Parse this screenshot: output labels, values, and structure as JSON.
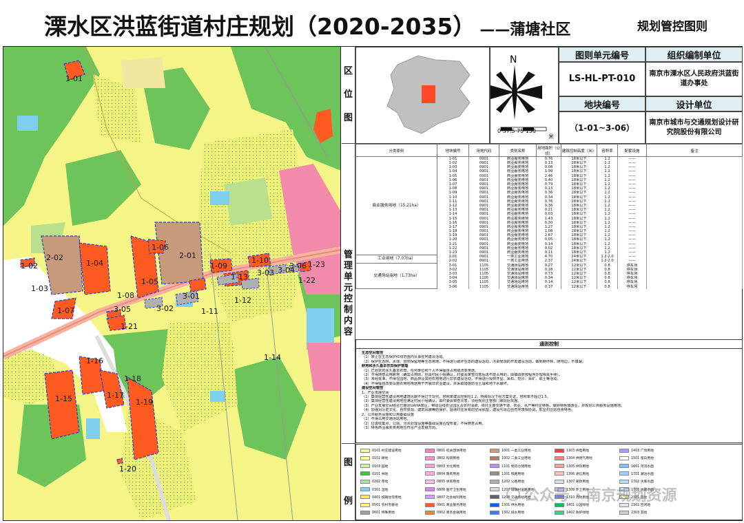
{
  "header": {
    "title": "溧水区洪蓝街道村庄规划（2020-2035）",
    "subtitle": "——蒲塘社区",
    "sheet_name": "规划管控图则"
  },
  "panel": {
    "location_label": [
      "区",
      "位",
      "图"
    ],
    "scale_label": "0 37.5 75    150",
    "scale_unit": "米",
    "north": "N",
    "unit_no_header": "图则单元编号",
    "unit_no": "LS-HL-PT-010",
    "plot_no_header": "地块编号",
    "plot_no": "（1-01~3-06）",
    "org_header": "组织编制单位",
    "org": "南京市溧水区人民政府洪蓝街道办事处",
    "design_header": "设计单位",
    "design": "南京市城市与交通规划设计研究院股份有限公司",
    "mgmt_label": [
      "管",
      "理",
      "单",
      "元",
      "控",
      "制",
      "内",
      "容"
    ],
    "legend_label": [
      "图",
      "例"
    ]
  },
  "table": {
    "headers": [
      "分类原则",
      "地块编号",
      "用地代码",
      "类别名称",
      "用地面积（公顷）",
      "建筑控制高度（米）",
      "容积率",
      "配套设施",
      "备注"
    ],
    "groups": [
      {
        "name": "商业服务用地（15.21ha）",
        "rows": [
          [
            "1-01",
            "0901",
            "商业服务用地",
            "0.76",
            "18米以下",
            "1.2",
            "——"
          ],
          [
            "1-02",
            "0901",
            "商业服务用地",
            "0.13",
            "18米以下",
            "1.2",
            "——"
          ],
          [
            "1-03",
            "0901",
            "商业服务用地",
            "0.08",
            "18米以下",
            "1.2",
            "——"
          ],
          [
            "1-04",
            "0901",
            "商业服务用地",
            "1.99",
            "18米以下",
            "1.2",
            "——"
          ],
          [
            "1-05",
            "0901",
            "商业服务用地",
            "2.46",
            "18米以下",
            "1.2",
            "——"
          ],
          [
            "1-06",
            "0901",
            "商业服务用地",
            "0.40",
            "18米以下",
            "1.2",
            "——"
          ],
          [
            "1-07",
            "0901",
            "商业服务用地",
            "0.79",
            "18米以下",
            "1.2",
            "——"
          ],
          [
            "1-08",
            "0901",
            "商业服务用地",
            "0.13",
            "18米以下",
            "1.2",
            "——"
          ],
          [
            "1-09",
            "0901",
            "商业服务用地",
            "0.36",
            "18米以下",
            "1.2",
            "——"
          ],
          [
            "1-10",
            "0901",
            "商业服务用地",
            "0.34",
            "18米以下",
            "1.2",
            "——"
          ],
          [
            "1-11",
            "0901",
            "商业服务用地",
            "0.76",
            "18米以下",
            "1.2",
            "——"
          ],
          [
            "1-12",
            "0901",
            "商业服务用地",
            "0.36",
            "18米以下",
            "1.2",
            "——"
          ],
          [
            "1-13",
            "0901",
            "商业服务用地",
            "0.21",
            "18米以下",
            "1.2",
            "——"
          ],
          [
            "1-14",
            "0901",
            "商业服务用地",
            "0.03",
            "18米以下",
            "1.2",
            "——"
          ],
          [
            "1-15",
            "0901",
            "商业服务用地",
            "1.43",
            "18米以下",
            "1.2",
            "——"
          ],
          [
            "1-16",
            "0901",
            "商业服务用地",
            "0.30",
            "18米以下",
            "1.2",
            "——"
          ],
          [
            "1-17",
            "0901",
            "商业服务用地",
            "1.27",
            "18米以下",
            "1.2",
            "——"
          ],
          [
            "1-18",
            "0901",
            "商业服务用地",
            "1.08",
            "18米以下",
            "1.2",
            "——"
          ],
          [
            "1-19",
            "0901",
            "商业服务用地",
            "2.67",
            "18米以下",
            "1.2",
            "——"
          ],
          [
            "1-20",
            "0901",
            "商业服务用地",
            "0.05",
            "18米以下",
            "1.2",
            "——"
          ],
          [
            "1-21",
            "0901",
            "商业服务用地",
            "0.14",
            "18米以下",
            "1.2",
            "——"
          ],
          [
            "1-22",
            "0901",
            "商业服务用地",
            "0.02",
            "18米以下",
            "1.2",
            "——"
          ],
          [
            "1-23",
            "0901",
            "商业服务用地",
            "0.11",
            "18米以下",
            "1.2",
            "——"
          ]
        ]
      },
      {
        "name": "工业用地（7.07ha）",
        "rows": [
          [
            "2-01",
            "0901",
            "一类工业用地",
            "4.70",
            "24米以下",
            "1.2-2.0",
            "——"
          ],
          [
            "2-02",
            "0901",
            "一类工业用地",
            "2.37",
            "24米以下",
            "1.2-2.0",
            "——"
          ]
        ]
      },
      {
        "name": "交通场站用地（1.73ha）",
        "rows": [
          [
            "3-01",
            "1105",
            "交通场站用地",
            "0.27",
            "12米以下",
            "0.8",
            "停车场"
          ],
          [
            "3-02",
            "1105",
            "交通场站用地",
            "0.28",
            "12米以下",
            "0.8",
            "停车场"
          ],
          [
            "3-03",
            "1105",
            "交通场站用地",
            "0.73",
            "12米以下",
            "0.8",
            "停车场"
          ],
          [
            "3-04",
            "1105",
            "交通场站用地",
            "0.34",
            "12米以下",
            "0.8",
            "停车场"
          ],
          [
            "3-05",
            "1105",
            "交通场站用地",
            "0.14",
            "12米以下",
            "0.8",
            "停车场"
          ],
          [
            "3-06",
            "1105",
            "交通场站用地",
            "0.37",
            "12米以下",
            "0.8",
            "停车场"
          ]
        ]
      }
    ]
  },
  "rules": {
    "title": "通则控制",
    "lines": [
      "生态空间管控",
      "（1）禁止在生态保护红线范围内从事任何建设活动。",
      "（2）保护生态林、水体、自然保留地等生态用地，不得进行破坏生态的建设活动，污染景观的开发建设活动，做到随坏林、随地边，不填湖。",
      "耕地和永久基本农田保护管理",
      "（1）已划定的永久基本农田，任何单位和个人不得擅自占用或改变用途。",
      "（2）不得随意占用耕地（确需占用的，应由村民小组确认，村委会审查同意后再不能占用的，由镇政府按程序办理相关手续）。",
      "（3）未经批准，不得在园地、商品林及其他农用地进行非农建设活动，不得进行毁林开垦、采石、挖沙、采矿、取土等活动。",
      "（4）不得擅自改变设施农用地用途用于开展非农业建设，并采取措施防治土壤和地下水破坏。",
      "建设空间管控",
      "1、产业发展空间",
      "（1）集体经营性建设用地建筑风貌不得过于现代，容积率建议控制在1.2，特殊情况下经方案论证，容积率不超过1.5。",
      "（2）集体经营性建设用地应满足村民小组确认、由村委会审查同意，须经规划主管部门审批后实施。",
      "（3）产业发展空间结合已整治UAHA景区，带动沿线农业园区及农村消费，依托主要交通干道、农业、水产等村庄特色，做好特色旅游业，并规划公共服务设施用地。",
      "（4）加强对历史文化、自然景观、建筑风貌等的保护，延续村庄原有的空间肌理，建设与周边自然环境相协调，彰显村庄的自身特色。",
      "2、公共服务设施和公用基础设施",
      "（1）不得占用交通场站用地。",
      "（2）垃圾收集点、公厕、污水处理设施等基础设施合理布置，不得随意占用。",
      "（3）特色商业服务类用地应符合产业发展方向。"
    ]
  },
  "legend_items": [
    [
      "0101 村庄建设用地",
      "#f5f5a0"
    ],
    [
      "0102 耕地",
      "#ffff99"
    ],
    [
      "0103 园地",
      "#d4f0a8"
    ],
    [
      "0201 林地",
      "#33cc33"
    ],
    [
      "0202 草地",
      "#a8e0a0"
    ],
    [
      "0301 湿地",
      "#80d0ff"
    ],
    [
      "0401 城镇住宅用地",
      "#ffe080"
    ],
    [
      "0501 农村宅基地",
      "#fff080"
    ],
    [
      "0601 特殊用地",
      "#a0a0a0"
    ],
    [
      "0801 机关团体用地",
      "#ff80c0"
    ],
    [
      "0802 科研用地",
      "#ff90d0"
    ],
    [
      "0803 文化用地",
      "#ffa0e0"
    ],
    [
      "0804 教育用地",
      "#ffb0e0"
    ],
    [
      "0805 体育用地",
      "#ffc0f0"
    ],
    [
      "0806 医疗卫生用地",
      "#e080ff"
    ],
    [
      "0807 社会福利用地",
      "#d0a0ff"
    ],
    [
      "0901 商业服务用地",
      "#ff6020"
    ],
    [
      "0902 商务金融用地",
      "#ff8040"
    ],
    [
      "1001 一类工业用地",
      "#c8a080"
    ],
    [
      "1002 二类工业用地",
      "#b08060"
    ],
    [
      "1101 物流仓储用地",
      "#c090f0"
    ],
    [
      "1201 铁路用地",
      "#909090"
    ],
    [
      "1202 公路用地",
      "#b0b0b0"
    ],
    [
      "1207 城镇村道路用地",
      "#d8d8d8"
    ],
    [
      "1208 交通场站用地",
      "#606060"
    ],
    [
      "1301 供水用地",
      "#0060ff"
    ],
    [
      "1302 排水用地",
      "#3080ff"
    ],
    [
      "1303 供电用地",
      "#ff4040"
    ],
    [
      "1304 供燃气用地",
      "#ff8080"
    ],
    [
      "1305 供热用地",
      "#ffa0a0"
    ],
    [
      "1306 通信用地",
      "#ffc0c0"
    ],
    [
      "1307 邮政用地",
      "#e0e0e0"
    ],
    [
      "1309 环卫用地",
      "#c0c0ff"
    ],
    [
      "1310 消防用地",
      "#8080ff"
    ],
    [
      "1401 公园绿地",
      "#00c060"
    ],
    [
      "1402 防护绿地",
      "#40d080"
    ],
    [
      "1403 广场用地",
      "#a0a0ff"
    ],
    [
      "1501 留白用地",
      "#ffffff"
    ],
    [
      "1601 河流水面",
      "#80c0ff"
    ],
    [
      "1701 湖泊水面",
      "#a0d0ff"
    ],
    [
      "1702 水库水面",
      "#b0e0ff"
    ],
    [
      "1703 坑塘水面",
      "#c0e8ff"
    ],
    [
      "2301 田坎",
      "#f0f0c0"
    ],
    [
      "2302 空闲地",
      "#e8e8e8"
    ],
    [
      "2303 其他",
      "#d0d0d0"
    ]
  ],
  "map": {
    "labels": [
      "1-01",
      "1-02",
      "1-03",
      "1-04",
      "1-05",
      "1-06",
      "1-07",
      "1-08",
      "1-09",
      "1-10",
      "1-11",
      "1-12",
      "1-13",
      "1-14",
      "1-15",
      "1-16",
      "1-17",
      "1-18",
      "1-19",
      "1-20",
      "1-21",
      "1-22",
      "1-23",
      "2-01",
      "2-02",
      "3-01",
      "3-02",
      "3-03",
      "3-04",
      "3-05",
      "3-06"
    ]
  },
  "watermark": "公众号 · 南京规划资源"
}
